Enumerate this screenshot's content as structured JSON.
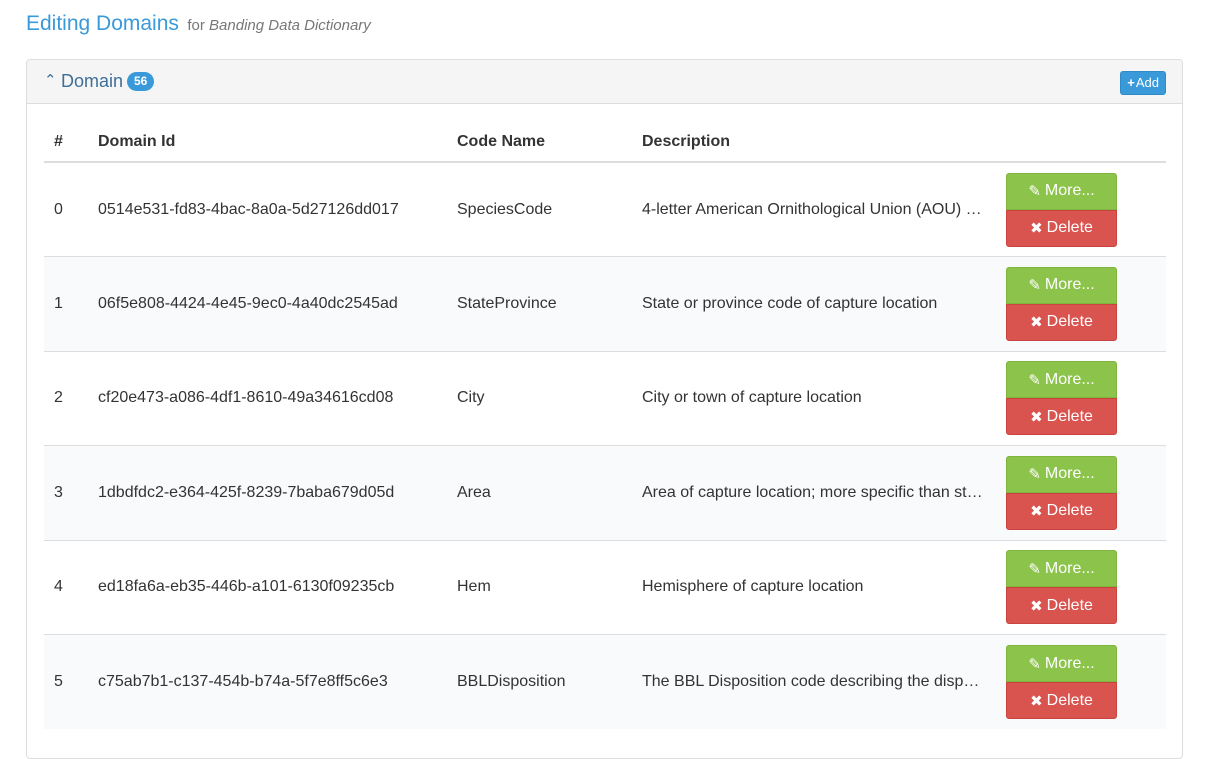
{
  "header": {
    "title": "Editing Domains",
    "for_text": "for",
    "dictionary_name": "Banding Data Dictionary"
  },
  "panel": {
    "title": "Domain",
    "count": "56",
    "add_label": "Add"
  },
  "table": {
    "columns": [
      "#",
      "Domain Id",
      "Code Name",
      "Description"
    ],
    "more_label": "More...",
    "delete_label": "Delete",
    "rows": [
      {
        "index": "0",
        "domain_id": "0514e531-fd83-4bac-8a0a-5d27126dd017",
        "code_name": "SpeciesCode",
        "description": "4-letter American Ornithological Union (AOU) …"
      },
      {
        "index": "1",
        "domain_id": "06f5e808-4424-4e45-9ec0-4a40dc2545ad",
        "code_name": "StateProvince",
        "description": "State or province code of capture location"
      },
      {
        "index": "2",
        "domain_id": "cf20e473-a086-4df1-8610-49a34616cd08",
        "code_name": "City",
        "description": "City or town of capture location"
      },
      {
        "index": "3",
        "domain_id": "1dbdfdc2-e364-425f-8239-7baba679d05d",
        "code_name": "Area",
        "description": "Area of capture location; more specific than st…"
      },
      {
        "index": "4",
        "domain_id": "ed18fa6a-eb35-446b-a101-6130f09235cb",
        "code_name": "Hem",
        "description": "Hemisphere of capture location"
      },
      {
        "index": "5",
        "domain_id": "c75ab7b1-c137-454b-b74a-5f7e8ff5c6e3",
        "code_name": "BBLDisposition",
        "description": "The BBL Disposition code describing the dispo…"
      }
    ]
  },
  "icons": {
    "collapse": "chevron-up-icon",
    "add": "plus-icon",
    "more": "pencil-icon",
    "delete": "times-icon"
  },
  "colors": {
    "accent": "#3a9ad9",
    "more_button": "#8cc34a",
    "delete_button": "#d9534f"
  }
}
